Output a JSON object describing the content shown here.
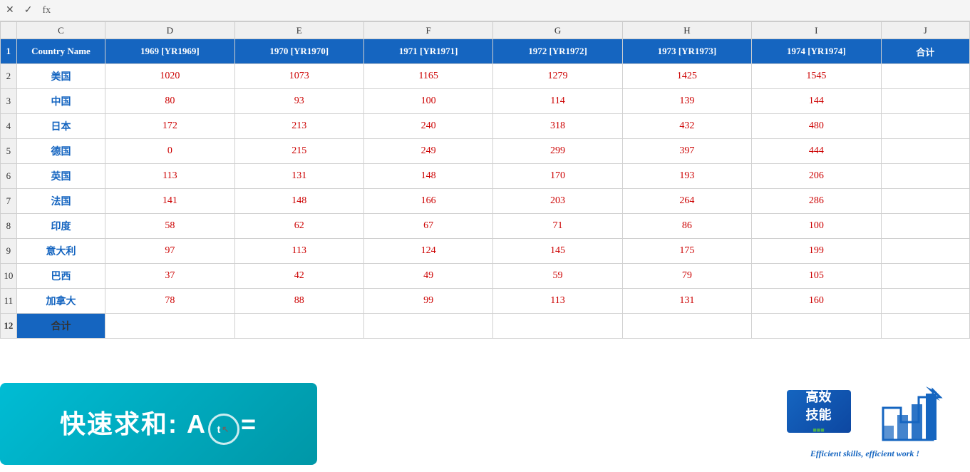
{
  "formula_bar": {
    "cancel_label": "✕",
    "confirm_label": "✓",
    "fx_label": "fx"
  },
  "columns": [
    "C",
    "D",
    "E",
    "F",
    "G",
    "H",
    "I",
    "J"
  ],
  "header": {
    "country_name": "Country Name",
    "cols": [
      "1969 [YR1969]",
      "1970 [YR1970]",
      "1971 [YR1971]",
      "1972 [YR1972]",
      "1973 [YR1973]",
      "1974 [YR1974]",
      "合计"
    ]
  },
  "rows": [
    {
      "country": "美国",
      "values": [
        "1020",
        "1073",
        "1165",
        "1279",
        "1425",
        "1545",
        ""
      ]
    },
    {
      "country": "中国",
      "values": [
        "80",
        "93",
        "100",
        "114",
        "139",
        "144",
        ""
      ]
    },
    {
      "country": "日本",
      "values": [
        "172",
        "213",
        "240",
        "318",
        "432",
        "480",
        ""
      ]
    },
    {
      "country": "德国",
      "values": [
        "0",
        "215",
        "249",
        "299",
        "397",
        "444",
        ""
      ]
    },
    {
      "country": "英国",
      "values": [
        "113",
        "131",
        "148",
        "170",
        "193",
        "206",
        ""
      ]
    },
    {
      "country": "法国",
      "values": [
        "141",
        "148",
        "166",
        "203",
        "264",
        "286",
        ""
      ]
    },
    {
      "country": "印度",
      "values": [
        "58",
        "62",
        "67",
        "71",
        "86",
        "100",
        ""
      ]
    },
    {
      "country": "意大利",
      "values": [
        "97",
        "113",
        "124",
        "145",
        "175",
        "199",
        ""
      ]
    },
    {
      "country": "巴西",
      "values": [
        "37",
        "42",
        "49",
        "59",
        "79",
        "105",
        ""
      ]
    },
    {
      "country": "加拿大",
      "values": [
        "78",
        "88",
        "99",
        "113",
        "131",
        "160",
        ""
      ]
    },
    {
      "country": "合计",
      "values": [
        "",
        "",
        "",
        "",
        "",
        "",
        ""
      ],
      "is_total": true
    }
  ],
  "tooltip": {
    "text_before": "快速求和: A",
    "text_cursor": "t",
    "text_after": "=",
    "label": "快速求和: Alt ="
  },
  "brand": {
    "line1": "高效",
    "line2": "技能",
    "tagline": "Efficient skills, efficient work !"
  }
}
